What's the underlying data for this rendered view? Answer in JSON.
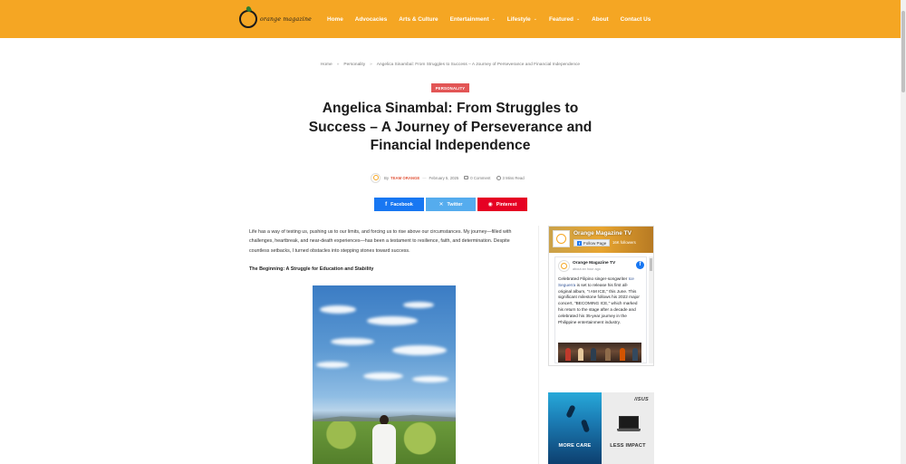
{
  "header": {
    "logo_text": "orange magazine",
    "nav": [
      {
        "label": "Home",
        "has_dropdown": false
      },
      {
        "label": "Advocacies",
        "has_dropdown": false
      },
      {
        "label": "Arts & Culture",
        "has_dropdown": false
      },
      {
        "label": "Entertainment",
        "has_dropdown": true
      },
      {
        "label": "Lifestyle",
        "has_dropdown": true
      },
      {
        "label": "Featured",
        "has_dropdown": true
      },
      {
        "label": "About",
        "has_dropdown": false
      },
      {
        "label": "Contact Us",
        "has_dropdown": false
      }
    ],
    "dropdown_icon": "chevron-down-icon"
  },
  "breadcrumb": [
    "Home",
    "Personality",
    "Angelica Sinambal: From Struggles to Success – A Journey of Perseverance and Financial Independence"
  ],
  "article": {
    "category": "PERSONALITY",
    "title": "Angelica Sinambal: From Struggles to Success – A Journey of Perseverance and Financial Independence",
    "meta": {
      "by": "By",
      "author": "TEAM ORANGE",
      "date": "February 5, 2025",
      "comments": "0 Comment",
      "read_time": "3 Mins Read"
    },
    "share": {
      "facebook": "Facebook",
      "twitter": "Twitter",
      "pinterest": "Pinterest"
    },
    "intro": "Life has a way of testing us, pushing us to our limits, and forcing us to rise above our circumstances. My journey—filled with challenges, heartbreak, and near-death experiences—has been a testament to resilience, faith, and determination. Despite countless setbacks, I turned obstacles into stepping stones toward success.",
    "section_heading": "The Beginning: A Struggle for Education and Stability"
  },
  "sidebar": {
    "fb_widget": {
      "page_name": "Orange Magazine TV",
      "follow_label": "Follow Page",
      "followers": "16K followers",
      "post_author": "Orange Magazine TV",
      "post_time": "about an hour ago",
      "post_text_before": "Celebrated Filipino singer-songwriter ",
      "post_link": "Ice Seguerra",
      "post_text_after": " is set to release his first all-original album, \"I AM ICE,\" this June. This significant milestone follows his 2022 major concert, \"BECOMING ICE,\" which marked his return to the stage after a decade and celebrated his 35-year journey in the Philippine entertainment industry."
    },
    "ad": {
      "brand": "/ISUS",
      "left_text": "MORE CARE",
      "right_text": "LESS IMPACT"
    }
  },
  "colors": {
    "header_bg": "#f5a623",
    "category_badge": "#e25555",
    "author_accent": "#e2583e",
    "facebook": "#1877f2",
    "twitter": "#55acee",
    "pinterest": "#e60023"
  }
}
